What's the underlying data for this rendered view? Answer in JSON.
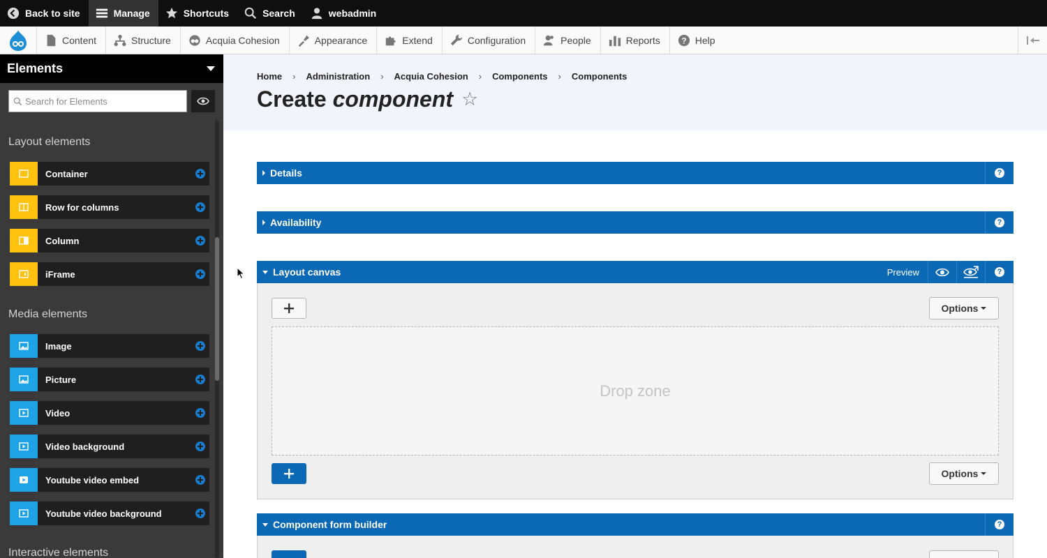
{
  "toolbar": {
    "back": "Back to site",
    "manage": "Manage",
    "shortcuts": "Shortcuts",
    "search": "Search",
    "user": "webadmin"
  },
  "menu": {
    "items": [
      "Content",
      "Structure",
      "Acquia Cohesion",
      "Appearance",
      "Extend",
      "Configuration",
      "People",
      "Reports",
      "Help"
    ]
  },
  "sidebar": {
    "title": "Elements",
    "search_placeholder": "Search for Elements",
    "sections": [
      "Layout elements",
      "Media elements",
      "Interactive elements"
    ],
    "layout_items": [
      "Container",
      "Row for columns",
      "Column",
      "iFrame"
    ],
    "media_items": [
      "Image",
      "Picture",
      "Video",
      "Video background",
      "Youtube video embed",
      "Youtube video background"
    ]
  },
  "breadcrumb": [
    "Home",
    "Administration",
    "Acquia Cohesion",
    "Components",
    "Components"
  ],
  "title": {
    "prefix": "Create",
    "emphasis": "component",
    "star": "☆"
  },
  "panels": {
    "details": "Details",
    "availability": "Availability",
    "layout_canvas": "Layout canvas",
    "preview": "Preview",
    "form_builder": "Component form builder",
    "help": "?"
  },
  "canvas": {
    "plus": "+",
    "options": "Options",
    "drop_zone": "Drop zone"
  },
  "colors": {
    "blue": "#0a68b4",
    "layout_yellow": "#ffc20e",
    "media_blue": "#1ea3e6"
  }
}
